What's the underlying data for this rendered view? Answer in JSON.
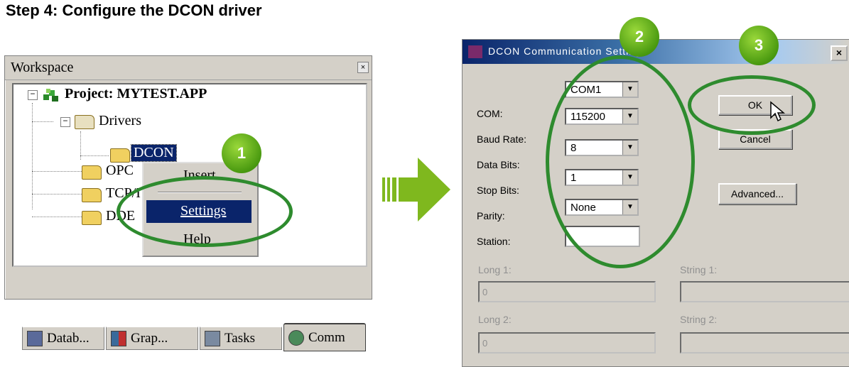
{
  "heading": "Step 4: Configure the DCON driver",
  "workspace": {
    "title": "Workspace",
    "close": "×",
    "tree": {
      "project": "Project: MYTEST.APP",
      "drivers": "Drivers",
      "dcon": "DCON",
      "opc": "OPC",
      "tcp": "TCP/I",
      "dde": "DDE"
    },
    "context_menu": {
      "insert": "Insert",
      "settings": "Settings",
      "help": "Help"
    },
    "tabs": [
      "Datab...",
      "Grap...",
      "Tasks",
      "Comm"
    ]
  },
  "dialog": {
    "title": "DCON Communication Settings",
    "close": "×",
    "fields": {
      "com_label": "COM:",
      "com_value": "COM1",
      "baud_label": "Baud Rate:",
      "baud_value": "115200",
      "data_label": "Data Bits:",
      "data_value": "8",
      "stop_label": "Stop Bits:",
      "stop_value": "1",
      "parity_label": "Parity:",
      "parity_value": "None",
      "station_label": "Station:",
      "station_value": ""
    },
    "buttons": {
      "ok": "OK",
      "cancel": "Cancel",
      "advanced": "Advanced..."
    },
    "disabled": {
      "long1_label": "Long 1:",
      "long1_value": "0",
      "string1_label": "String 1:",
      "string1_value": "",
      "long2_label": "Long 2:",
      "long2_value": "0",
      "string2_label": "String 2:",
      "string2_value": ""
    }
  },
  "badges": [
    "1",
    "2",
    "3"
  ],
  "colors": {
    "annotation_green": "#2e8b2e",
    "arrow_green": "#7fb81e",
    "selection_blue": "#0a246a"
  }
}
